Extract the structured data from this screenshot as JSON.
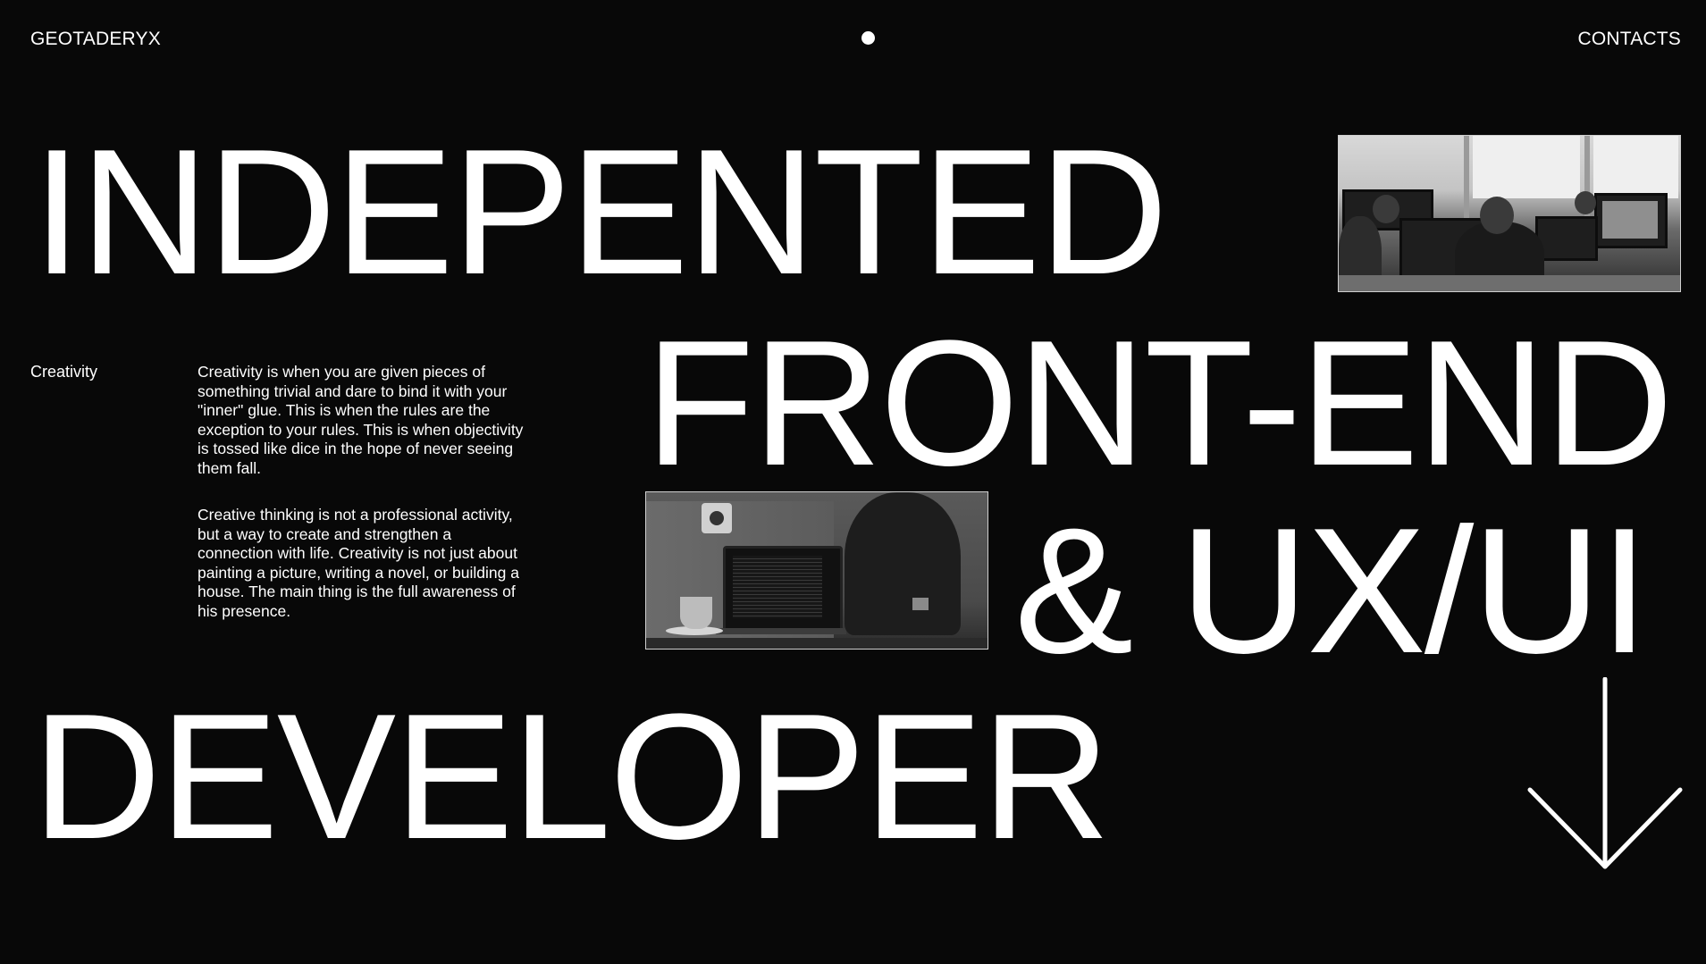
{
  "header": {
    "brand": "GEOTADERYX",
    "contacts": "CONTACTS"
  },
  "hero": {
    "line1": "INDEPENTED",
    "line2": "FRONT-END",
    "line3": "& UX/UI",
    "line4": "DEVELOPER"
  },
  "about": {
    "label": "Creativity",
    "paragraph1": "Creativity is when you are given pieces of something trivial and dare to bind it with your \"inner\" glue. This is when the rules are the exception to your rules. This is when objectivity is tossed like dice in the hope of never seeing them fall.",
    "paragraph2": "Creative thinking is not a professional activity, but a way to create and strengthen a connection with life. Creativity is not just about painting a picture, writing a novel, or building a house. The main thing is the full awareness of his presence."
  },
  "icons": {
    "center_dot": "dot-icon",
    "scroll": "arrow-down-icon"
  },
  "colors": {
    "background": "#080808",
    "foreground": "#ffffff"
  }
}
